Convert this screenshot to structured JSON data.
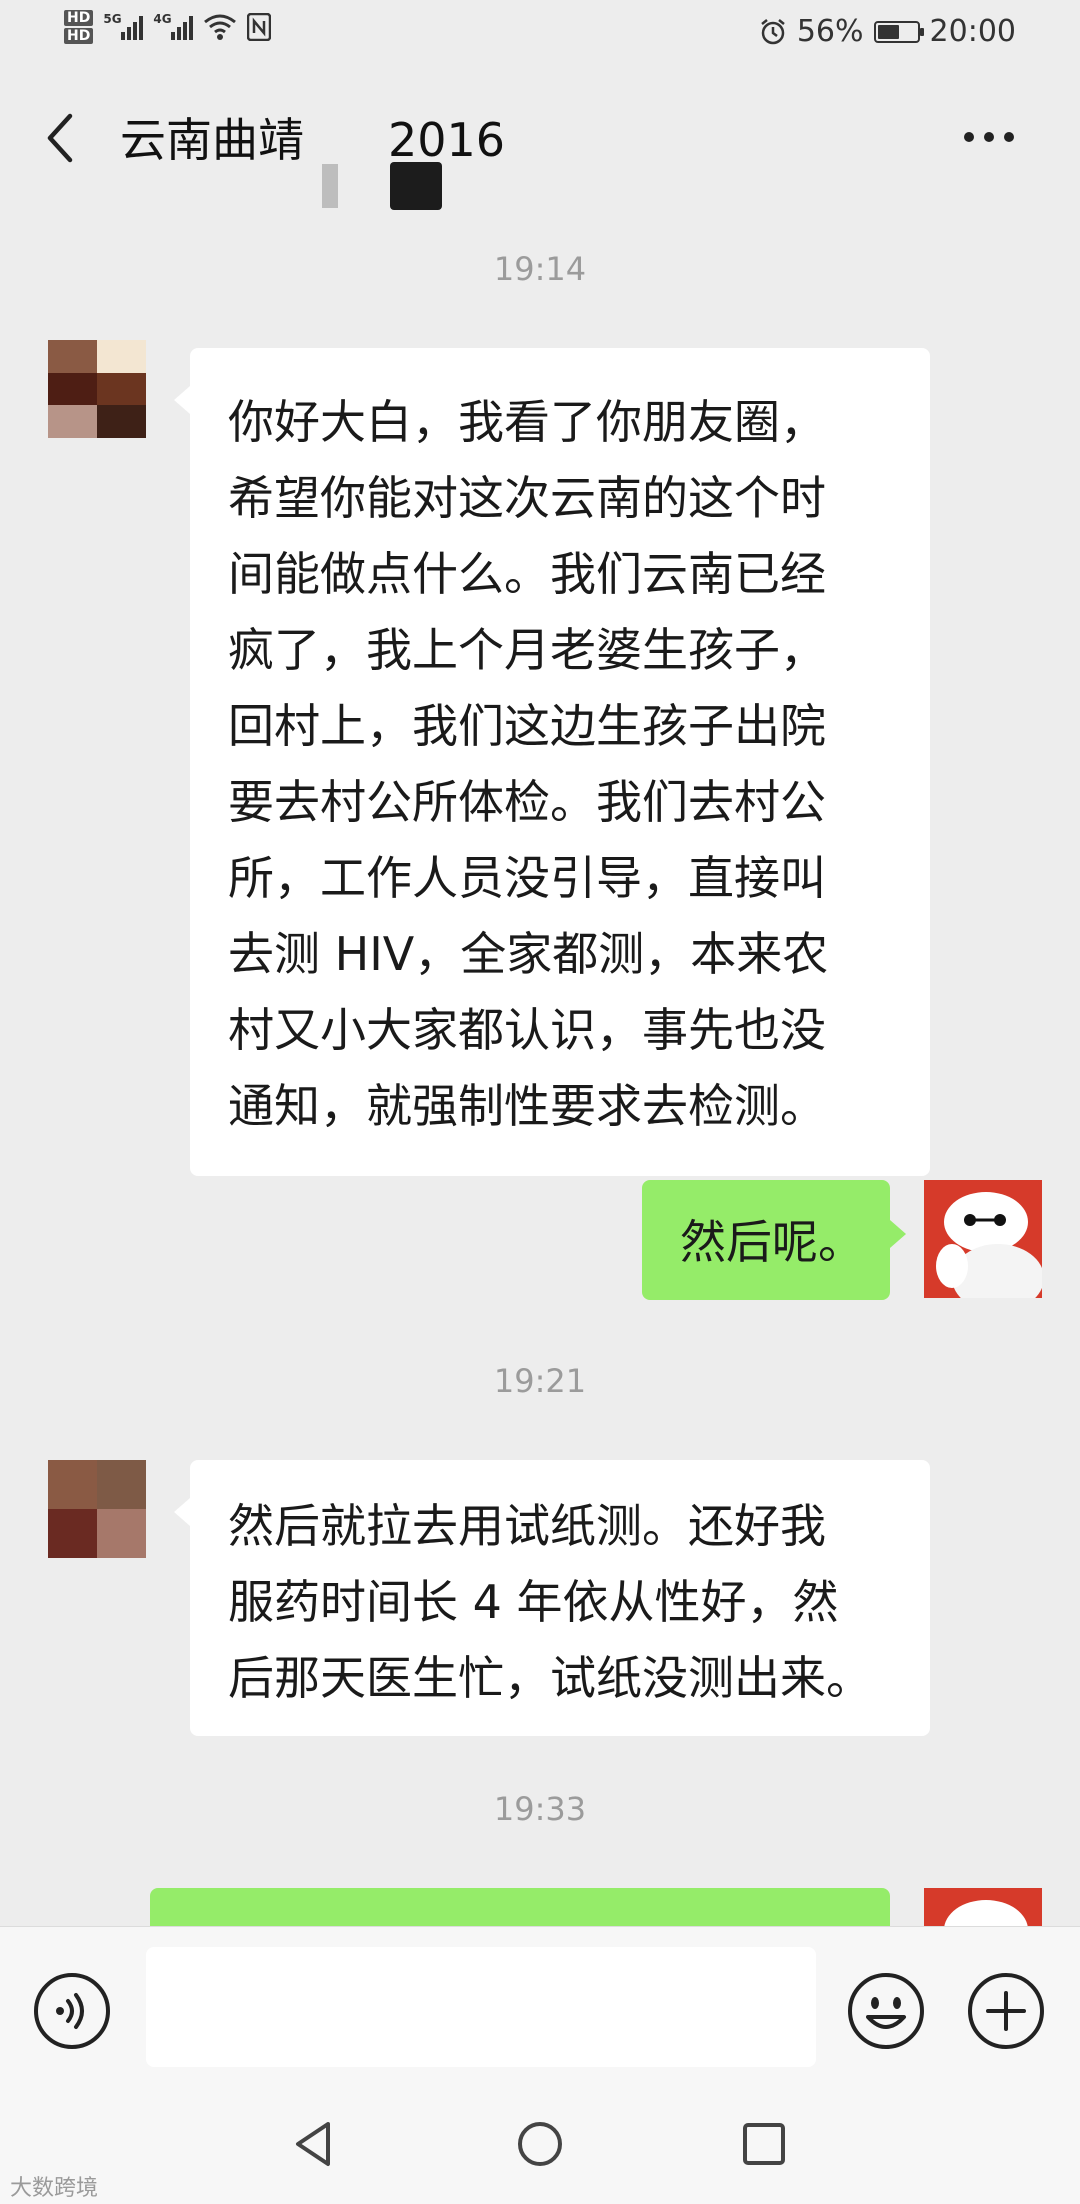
{
  "status_bar": {
    "hd1": "HD",
    "hd2": "HD",
    "net1": "5G",
    "net2": "4G",
    "battery_text": "56%",
    "battery_level": 0.56,
    "time": "20:00"
  },
  "header": {
    "title": "云南曲靖",
    "title_suffix": "2016"
  },
  "chat": {
    "timestamps": [
      "19:14",
      "19:21",
      "19:33"
    ],
    "messages": [
      {
        "side": "left",
        "text": "你好大白，我看了你朋友圈，\n希望你能对这次云南的这个时\n间能做点什么。我们云南已经\n疯了，我上个月老婆生孩子，\n回村上，我们这边生孩子出院\n要去村公所体检。我们去村公\n所，工作人员没引导，直接叫\n去测 HIV，全家都测，本来农\n村又小大家都认识，事先也没\n通知，就强制性要求去检测。"
      },
      {
        "side": "right",
        "text": "然后呢。"
      },
      {
        "side": "left",
        "text": "然后就拉去用试纸测。还好我\n服药时间长 4 年依从性好，然\n后那天医生忙，试纸没测出来。"
      },
      {
        "side": "right",
        "text": ""
      }
    ]
  },
  "input": {
    "placeholder": ""
  },
  "watermark": "大数跨境",
  "colors": {
    "background": "#ededed",
    "bubble_sent": "#95ec69",
    "bubble_received": "#ffffff",
    "timestamp": "#9b9b9b"
  },
  "icons": {
    "back": "chevron-left-icon",
    "more": "more-dots-icon",
    "voice": "voice-icon",
    "emoji": "emoji-icon",
    "plus": "plus-icon",
    "nav_back": "triangle-back-icon",
    "nav_home": "circle-home-icon",
    "nav_recent": "square-recent-icon"
  }
}
